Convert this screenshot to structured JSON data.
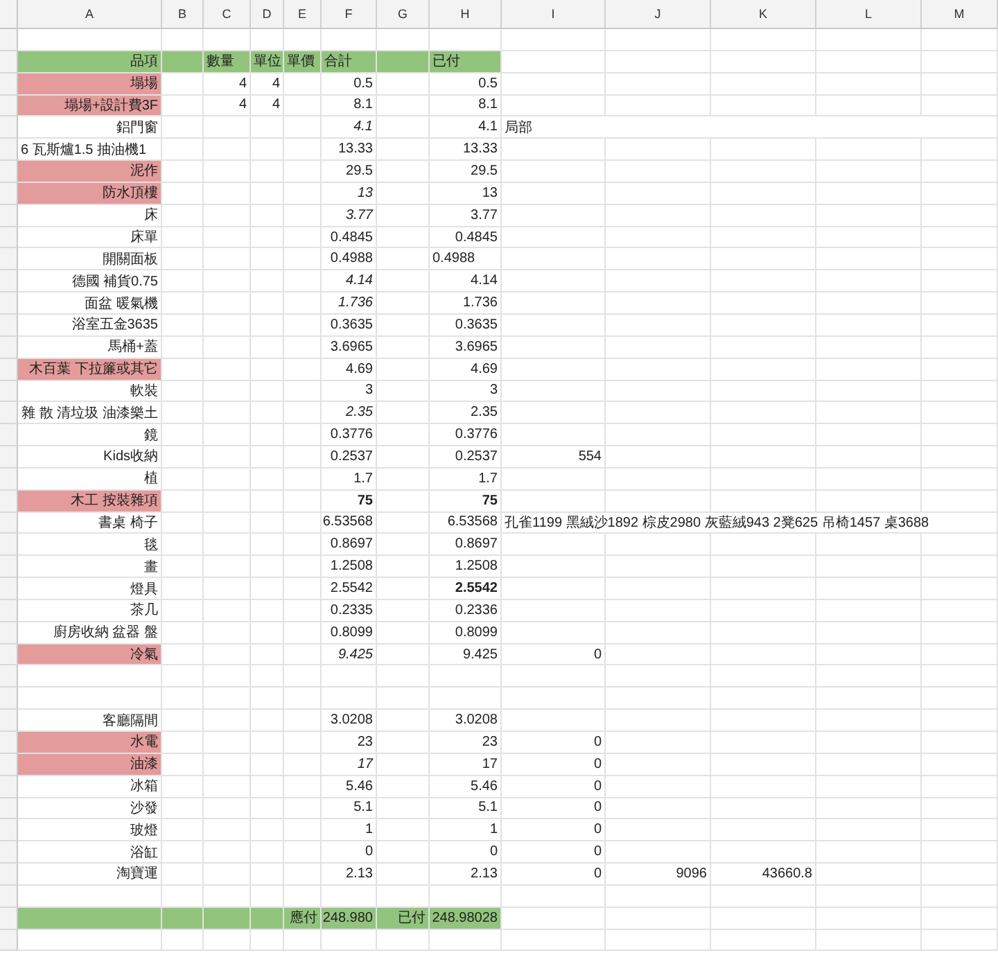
{
  "columns": [
    "A",
    "B",
    "C",
    "D",
    "E",
    "F",
    "G",
    "H",
    "I",
    "J",
    "K",
    "L",
    "M"
  ],
  "rows": [
    {
      "kind": "blank"
    },
    {
      "kind": "header",
      "cells": {
        "A": "品項",
        "C": "數量",
        "D": "單位",
        "E": "單價",
        "F": "合計",
        "H": "已付"
      }
    },
    {
      "kind": "item",
      "highlighted": true,
      "cells": {
        "A": "塌場",
        "C": "4",
        "D": "4",
        "F": "0.5",
        "H": "0.5"
      }
    },
    {
      "kind": "item",
      "highlighted": true,
      "cells": {
        "A": "塌場+設計費3F",
        "C": "4",
        "D": "4",
        "F": "8.1",
        "H": "8.1"
      }
    },
    {
      "kind": "item",
      "highlighted": false,
      "cells": {
        "A": "鋁門窗",
        "F": {
          "text": "4.1",
          "italic": true
        },
        "H": "4.1",
        "I": {
          "text": "局部",
          "left": true
        }
      }
    },
    {
      "kind": "item",
      "highlighted": false,
      "cells": {
        "A": {
          "text": "6 瓦斯爐1.5 抽油機1",
          "left": true
        },
        "F": "13.33",
        "H": "13.33"
      }
    },
    {
      "kind": "item",
      "highlighted": true,
      "cells": {
        "A": "泥作",
        "F": "29.5",
        "H": "29.5"
      }
    },
    {
      "kind": "item",
      "highlighted": true,
      "cells": {
        "A": "防水頂樓",
        "F": {
          "text": "13",
          "italic": true
        },
        "H": "13"
      }
    },
    {
      "kind": "item",
      "highlighted": false,
      "cells": {
        "A": "床",
        "F": {
          "text": "3.77",
          "italic": true
        },
        "H": "3.77"
      }
    },
    {
      "kind": "item",
      "highlighted": false,
      "cells": {
        "A": "床單",
        "F": "0.4845",
        "H": "0.4845"
      }
    },
    {
      "kind": "item",
      "highlighted": false,
      "cells": {
        "A": "開關面板",
        "F": "0.4988",
        "H": {
          "text": "0.4988",
          "left": true
        }
      }
    },
    {
      "kind": "item",
      "highlighted": false,
      "cells": {
        "A": "德國 補貨0.75",
        "F": {
          "text": "4.14",
          "italic": true
        },
        "H": "4.14"
      }
    },
    {
      "kind": "item",
      "highlighted": false,
      "cells": {
        "A": "面盆 暖氣機",
        "F": {
          "text": "1.736",
          "italic": true
        },
        "H": "1.736"
      }
    },
    {
      "kind": "item",
      "highlighted": false,
      "cells": {
        "A": "浴室五金3635",
        "F": "0.3635",
        "H": "0.3635"
      }
    },
    {
      "kind": "item",
      "highlighted": false,
      "cells": {
        "A": "馬桶+蓋",
        "F": "3.6965",
        "H": "3.6965"
      }
    },
    {
      "kind": "item",
      "highlighted": true,
      "cells": {
        "A": "木百葉 下拉簾或其它",
        "F": "4.69",
        "H": "4.69"
      }
    },
    {
      "kind": "item",
      "highlighted": false,
      "cells": {
        "A": "軟裝",
        "F": "3",
        "H": "3"
      }
    },
    {
      "kind": "item",
      "highlighted": false,
      "cells": {
        "A": "雜 散 清垃圾 油漆樂土",
        "F": {
          "text": "2.35",
          "italic": true
        },
        "H": "2.35"
      }
    },
    {
      "kind": "item",
      "highlighted": false,
      "cells": {
        "A": "鏡",
        "F": "0.3776",
        "H": "0.3776"
      }
    },
    {
      "kind": "item",
      "highlighted": false,
      "cells": {
        "A": "Kids收納",
        "F": "0.2537",
        "H": "0.2537",
        "I": "554"
      }
    },
    {
      "kind": "item",
      "highlighted": false,
      "cells": {
        "A": "植",
        "F": "1.7",
        "H": "1.7"
      }
    },
    {
      "kind": "item",
      "highlighted": true,
      "cells": {
        "A": "木工 按裝雜項",
        "F": {
          "text": "75",
          "bold": true
        },
        "H": {
          "text": "75",
          "bold": true
        }
      }
    },
    {
      "kind": "item",
      "highlighted": false,
      "cells": {
        "A": "書桌 椅子",
        "F": "6.53568",
        "H": "6.53568",
        "I": {
          "text": "孔雀1199 黑絨沙1892 棕皮2980 灰藍絨943 2凳625 吊椅1457 桌3688",
          "left": true
        }
      }
    },
    {
      "kind": "item",
      "highlighted": false,
      "cells": {
        "A": "毯",
        "F": "0.8697",
        "H": "0.8697"
      }
    },
    {
      "kind": "item",
      "highlighted": false,
      "cells": {
        "A": "畫",
        "F": "1.2508",
        "H": "1.2508"
      }
    },
    {
      "kind": "item",
      "highlighted": false,
      "cells": {
        "A": "燈具",
        "F": "2.5542",
        "H": {
          "text": "2.5542",
          "bold": true
        }
      }
    },
    {
      "kind": "item",
      "highlighted": false,
      "cells": {
        "A": "茶几",
        "F": "0.2335",
        "H": "0.2336"
      }
    },
    {
      "kind": "item",
      "highlighted": false,
      "cells": {
        "A": "廚房收納 盆器 盤",
        "F": "0.8099",
        "H": "0.8099"
      }
    },
    {
      "kind": "item",
      "highlighted": true,
      "cells": {
        "A": "冷氣",
        "F": {
          "text": "9.425",
          "italic": true
        },
        "H": "9.425",
        "I": "0"
      }
    },
    {
      "kind": "blank"
    },
    {
      "kind": "blank"
    },
    {
      "kind": "item",
      "highlighted": false,
      "cells": {
        "A": "客廳隔間",
        "F": "3.0208",
        "H": "3.0208"
      }
    },
    {
      "kind": "item",
      "highlighted": true,
      "cells": {
        "A": "水電",
        "F": "23",
        "H": "23",
        "I": "0"
      }
    },
    {
      "kind": "item",
      "highlighted": true,
      "cells": {
        "A": "油漆",
        "F": {
          "text": "17",
          "italic": true
        },
        "H": "17",
        "I": "0"
      }
    },
    {
      "kind": "item",
      "highlighted": false,
      "cells": {
        "A": "冰箱",
        "F": "5.46",
        "H": "5.46",
        "I": "0"
      }
    },
    {
      "kind": "item",
      "highlighted": false,
      "cells": {
        "A": "沙發",
        "F": "5.1",
        "H": "5.1",
        "I": "0"
      }
    },
    {
      "kind": "item",
      "highlighted": false,
      "cells": {
        "A": "玻燈",
        "F": "1",
        "H": "1",
        "I": "0"
      }
    },
    {
      "kind": "item",
      "highlighted": false,
      "cells": {
        "A": "浴缸",
        "F": "0",
        "H": "0",
        "I": "0"
      }
    },
    {
      "kind": "item",
      "highlighted": false,
      "cells": {
        "A": "淘寶運",
        "F": "2.13",
        "H": "2.13",
        "I": "0",
        "J": "9096",
        "K": "43660.8"
      }
    },
    {
      "kind": "blank"
    },
    {
      "kind": "total",
      "cells": {
        "E": "應付",
        "F": "248.980",
        "G": "已付",
        "H": "248.98028"
      }
    },
    {
      "kind": "blank"
    }
  ]
}
